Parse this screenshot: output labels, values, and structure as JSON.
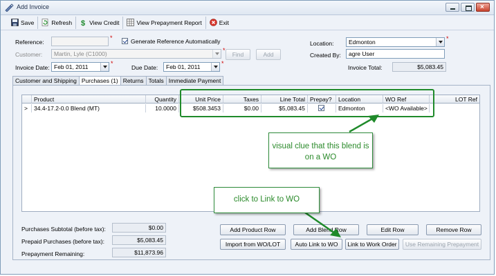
{
  "window": {
    "title": "Add Invoice",
    "icon": "invoice-pen-icon"
  },
  "toolbar": {
    "save": "Save",
    "refresh": "Refresh",
    "view_credit": "View Credit",
    "view_prepayment_report": "View Prepayment Report",
    "exit": "Exit"
  },
  "form": {
    "reference_label": "Reference:",
    "reference_value": "",
    "generate_reference_label": "Generate Reference Automatically",
    "generate_reference_checked": true,
    "customer_label": "Customer:",
    "customer_value": "Martin, Lyle (C1000)",
    "find_button": "Find",
    "add_button": "Add",
    "invoice_date_label": "Invoice Date:",
    "invoice_date_value": "Feb 01, 2011",
    "due_date_label": "Due Date:",
    "due_date_value": "Feb 01, 2011",
    "location_label": "Location:",
    "location_value": "Edmonton",
    "created_by_label": "Created By:",
    "created_by_value": "agre User",
    "invoice_total_label": "Invoice Total:",
    "invoice_total_value": "$5,083.45"
  },
  "tabs": [
    {
      "label": "Customer and Shipping",
      "active": false
    },
    {
      "label": "Purchases (1)",
      "active": true
    },
    {
      "label": "Returns",
      "active": false
    },
    {
      "label": "Totals",
      "active": false
    },
    {
      "label": "Immediate Payment",
      "active": false
    }
  ],
  "grid": {
    "columns": [
      "Product",
      "Quantity",
      "Unit Price",
      "Taxes",
      "Line Total",
      "Prepay?",
      "Location",
      "WO Ref",
      "LOT Ref"
    ],
    "rows": [
      {
        "indicator": ">",
        "product": "34.4-17.2-0.0 Blend (MT)",
        "quantity": "10.0000",
        "unit_price": "$508.3453",
        "taxes": "$0.00",
        "line_total": "$5,083.45",
        "prepay": true,
        "location": "Edmonton",
        "wo_ref": "<WO Available>",
        "lot_ref": ""
      }
    ]
  },
  "summary": {
    "purchases_subtotal_label": "Purchases Subtotal (before tax):",
    "purchases_subtotal_value": "$0.00",
    "prepaid_purchases_label": "Prepaid Purchases (before tax):",
    "prepaid_purchases_value": "$5,083.45",
    "prepayment_remaining_label": "Prepayment Remaining:",
    "prepayment_remaining_value": "$11,873.96"
  },
  "actions": {
    "add_product_row": "Add Product Row",
    "add_blend_row": "Add Blend Row",
    "edit_row": "Edit Row",
    "remove_row": "Remove Row",
    "import_from_wo_lot": "Import from WO/LOT",
    "auto_link_to_wo": "Auto Link to WO",
    "link_to_work_order": "Link to Work Order",
    "use_remaining_prepayment": "Use Remaining Prepayment"
  },
  "annotations": {
    "visual_clue_text": "visual clue that this blend is on a WO",
    "click_link_text": "click to Link to WO",
    "color": "#1f8a2a"
  },
  "colors": {
    "required_marker": "#d00000",
    "annotation_green": "#1f8a2a"
  }
}
